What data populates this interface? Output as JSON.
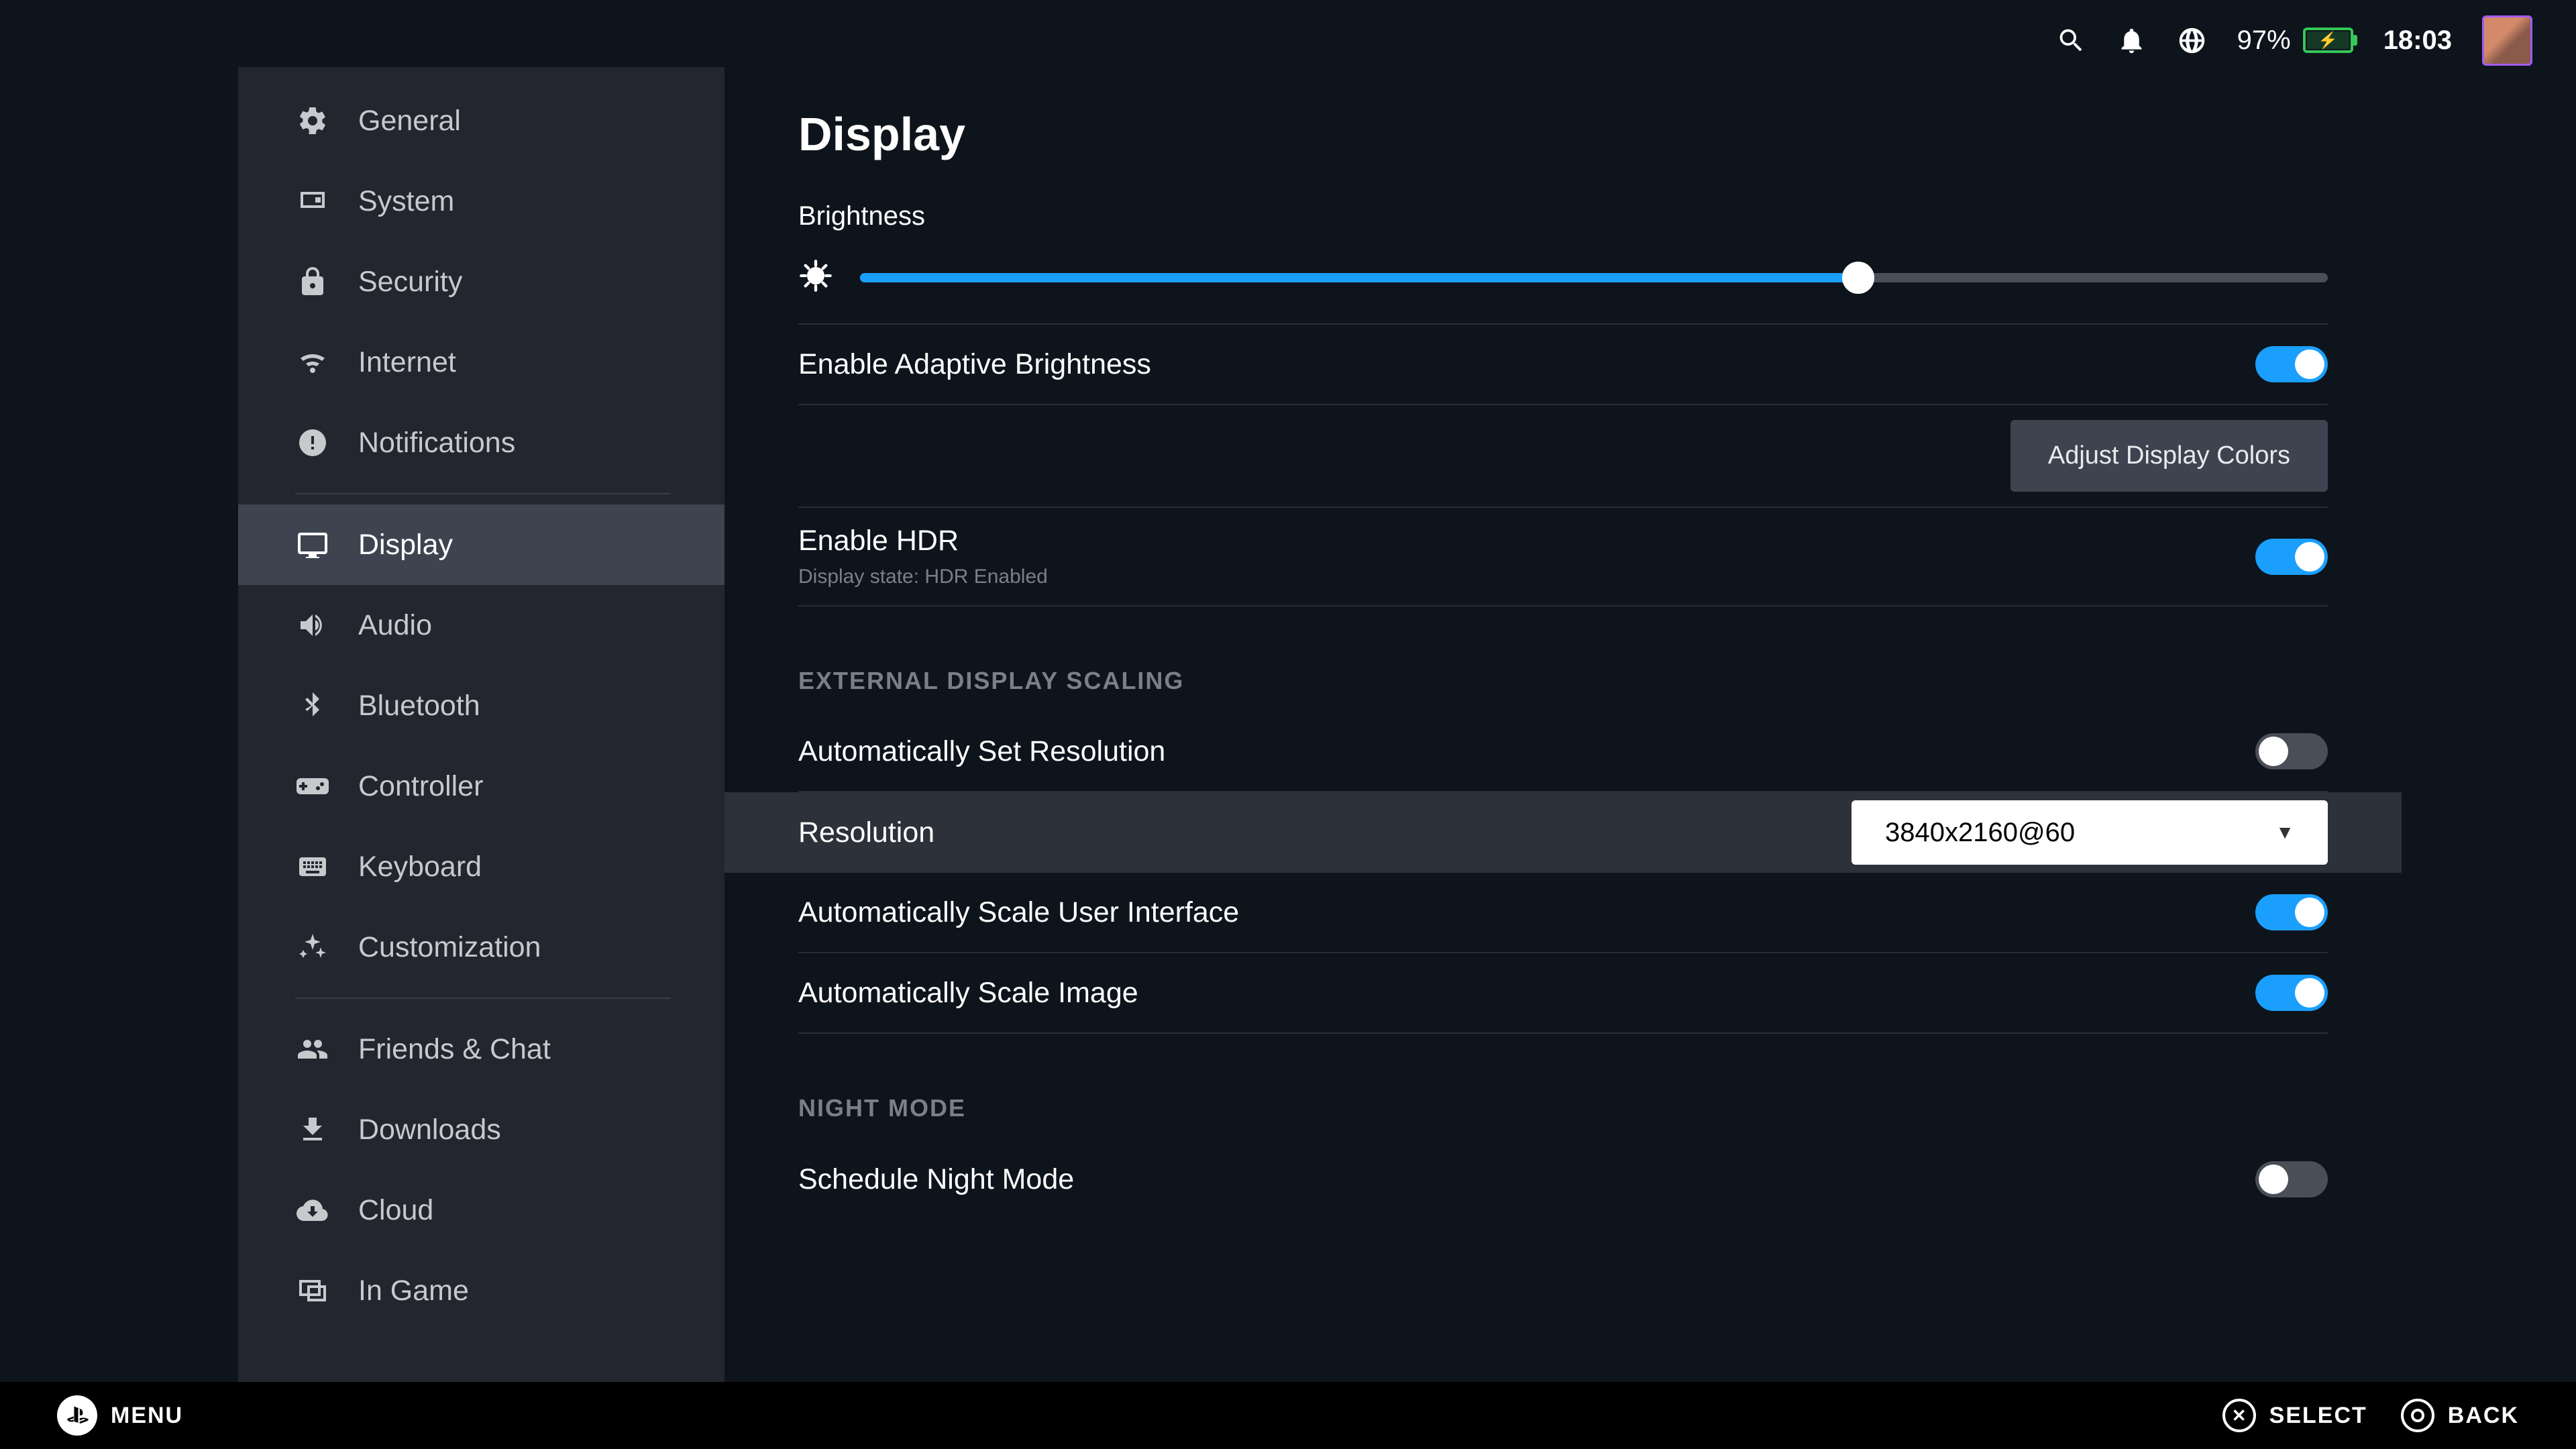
{
  "status": {
    "battery_pct": "97%",
    "clock": "18:03"
  },
  "sidebar": {
    "items": [
      {
        "id": "general",
        "label": "General"
      },
      {
        "id": "system",
        "label": "System"
      },
      {
        "id": "security",
        "label": "Security"
      },
      {
        "id": "internet",
        "label": "Internet"
      },
      {
        "id": "notifications",
        "label": "Notifications"
      },
      {
        "id": "display",
        "label": "Display"
      },
      {
        "id": "audio",
        "label": "Audio"
      },
      {
        "id": "bluetooth",
        "label": "Bluetooth"
      },
      {
        "id": "controller",
        "label": "Controller"
      },
      {
        "id": "keyboard",
        "label": "Keyboard"
      },
      {
        "id": "customization",
        "label": "Customization"
      },
      {
        "id": "friends",
        "label": "Friends & Chat"
      },
      {
        "id": "downloads",
        "label": "Downloads"
      },
      {
        "id": "cloud",
        "label": "Cloud"
      },
      {
        "id": "ingame",
        "label": "In Game"
      }
    ],
    "active_id": "display"
  },
  "page": {
    "title": "Display",
    "brightness": {
      "label": "Brightness",
      "value_pct": 68
    },
    "adaptive": {
      "label": "Enable Adaptive Brightness",
      "on": true
    },
    "adjust_colors_btn": "Adjust Display Colors",
    "hdr": {
      "label": "Enable HDR",
      "on": true,
      "sublabel": "Display state: HDR Enabled"
    },
    "ext_heading": "EXTERNAL DISPLAY SCALING",
    "auto_res": {
      "label": "Automatically Set Resolution",
      "on": false
    },
    "resolution": {
      "label": "Resolution",
      "value": "3840x2160@60"
    },
    "auto_scale_ui": {
      "label": "Automatically Scale User Interface",
      "on": true
    },
    "auto_scale_img": {
      "label": "Automatically Scale Image",
      "on": true
    },
    "night_heading": "NIGHT MODE",
    "schedule_night": {
      "label": "Schedule Night Mode",
      "on": false
    }
  },
  "bottombar": {
    "menu": "MENU",
    "select": "SELECT",
    "back": "BACK"
  }
}
